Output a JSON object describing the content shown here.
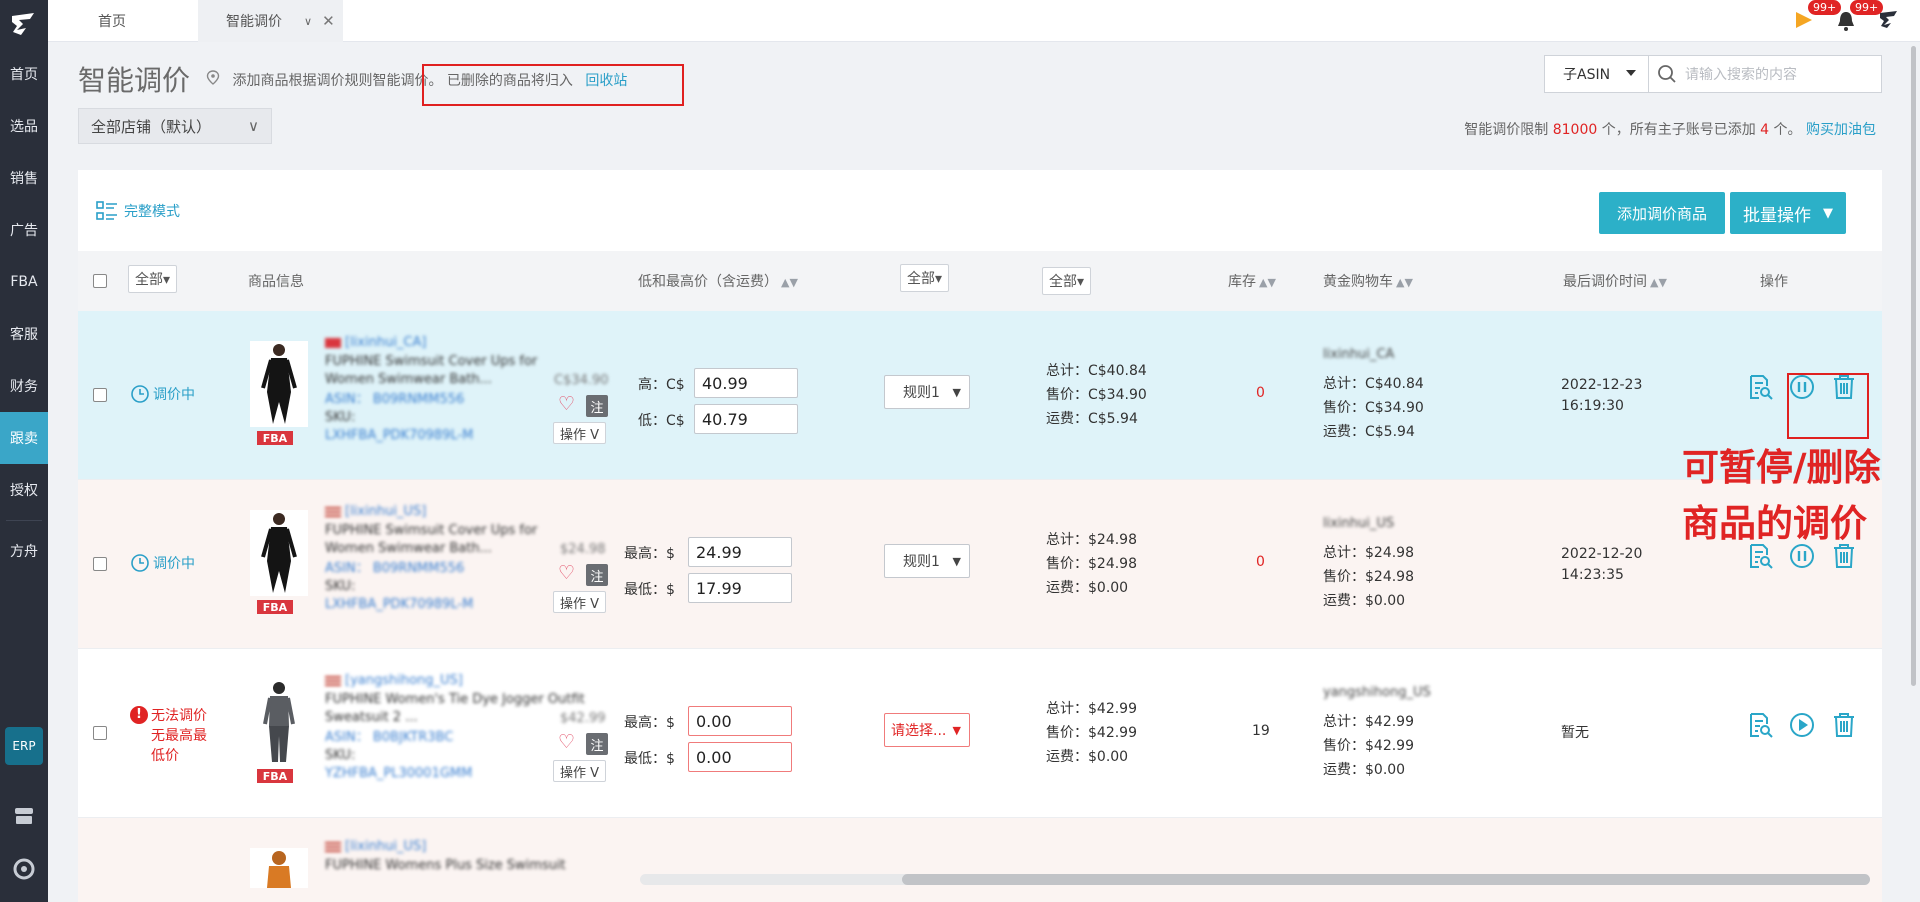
{
  "sidebar": {
    "items": [
      "首页",
      "选品",
      "销售",
      "广告",
      "FBA",
      "客服",
      "财务",
      "跟卖",
      "授权",
      "方舟"
    ],
    "active_index": 7,
    "erp": "ERP"
  },
  "tabs": {
    "home": "首页",
    "current": "智能调价"
  },
  "header": {
    "badge1": "99+",
    "badge2": "99+"
  },
  "page": {
    "title": "智能调价",
    "hint": "添加商品根据调价规则智能调价。 已删除的商品将归入",
    "recycle_link": "回收站",
    "store_select": "全部店铺（默认）"
  },
  "search": {
    "type": "子ASIN",
    "placeholder": "请输入搜索的内容"
  },
  "limit": {
    "prefix": "智能调价限制",
    "total": "81000",
    "mid": "个，所有主子账号已添加",
    "added": "4",
    "suffix": "个。",
    "link": "购买加油包"
  },
  "toolbar": {
    "mode": "完整模式",
    "add_button": "添加调价商品",
    "batch_button": "批量操作"
  },
  "table_header": {
    "all_status": "全部▾",
    "product_info": "商品信息",
    "price_range": "低和最高价（含运费）",
    "rule_all": "全部▾",
    "fee_all": "全部▾",
    "stock": "库存",
    "buybox": "黄金购物车",
    "last_time": "最后调价时间",
    "ops": "操作"
  },
  "rows": [
    {
      "status": "调价中",
      "status_type": "ok",
      "shop": "[lixinhui_CA]",
      "title1": "FUPHINE Swimsuit Cover Ups for",
      "title2": "Women Swimwear Bath...",
      "old_price": "C$34.90",
      "asin": "ASIN： B09RNMM556",
      "sku_label": "SKU:",
      "sku": "LXHFBA_PDK70989L-M",
      "op_label": "操作 V",
      "high_label": "高：",
      "low_label": "低：",
      "currency": "C$",
      "max_price": "40.99",
      "min_price": "40.79",
      "rule": "规则1",
      "total": "总计：C$40.84",
      "sell": "售价：C$34.90",
      "ship": "运费：C$5.94",
      "stock": "0",
      "buybox_seller": "lixinhui_CA",
      "bb_total": "总计：C$40.84",
      "bb_sell": "售价：C$34.90",
      "bb_ship": "运费：C$5.94",
      "time1": "2022-12-23",
      "time2": "16:19:30"
    },
    {
      "status": "调价中",
      "status_type": "ok",
      "shop": "[lixinhui_US]",
      "title1": "FUPHINE Swimsuit Cover Ups for",
      "title2": "Women Swimwear Bath...",
      "old_price": "$24.98",
      "asin": "ASIN： B09RNMM556",
      "sku_label": "SKU:",
      "sku": "LXHFBA_PDK70989L-M",
      "op_label": "操作 V",
      "high_label": "最高：",
      "low_label": "最低：",
      "currency": "$",
      "max_price": "24.99",
      "min_price": "17.99",
      "rule": "规则1",
      "total": "总计：$24.98",
      "sell": "售价：$24.98",
      "ship": "运费：$0.00",
      "stock": "0",
      "buybox_seller": "lixinhui_US",
      "bb_total": "总计：$24.98",
      "bb_sell": "售价：$24.98",
      "bb_ship": "运费：$0.00",
      "time1": "2022-12-20",
      "time2": "14:23:35"
    },
    {
      "status": "无法调价 无最高最低价",
      "status_type": "err",
      "shop": "[yangshihong_US]",
      "title1": "FUPHINE Women's Tie Dye Jogger Outfit",
      "title2": "Sweatsuit 2 ...",
      "old_price": "$42.99",
      "asin": "ASIN： B0BJKTR3BC",
      "sku_label": "SKU:",
      "sku": "YZHFBA_PL30001GMM",
      "op_label": "操作 V",
      "high_label": "最高：",
      "low_label": "最低：",
      "currency": "$",
      "max_price": "0.00",
      "min_price": "0.00",
      "rule": "请选择...",
      "total": "总计：$42.99",
      "sell": "售价：$42.99",
      "ship": "运费：$0.00",
      "stock": "19",
      "buybox_seller": "yangshihong_US",
      "bb_total": "总计：$42.99",
      "bb_sell": "售价：$42.99",
      "bb_ship": "运费：$0.00",
      "time1": "暂无",
      "time2": ""
    }
  ],
  "partial_row": {
    "shop": "[lixinhui_US]",
    "title1": "FUPHINE Womens Plus Size Swimsuit"
  },
  "annotation": {
    "line1": "可暂停/删除",
    "line2": "商品的调价"
  },
  "colors": {
    "accent": "#2cb0c8",
    "link": "#2a9fc8",
    "red": "#e02424",
    "row1_bg": "#dff3f9",
    "row2_bg": "#fbf4f2",
    "sidebar": "#2a2f3a"
  },
  "icons": [
    "logo-icon",
    "flag-icon",
    "bell-icon",
    "user-icon",
    "search-icon",
    "clock-icon",
    "error-icon",
    "heart-icon",
    "log-icon",
    "pause-icon",
    "play-icon",
    "trash-icon",
    "store-icon",
    "help-icon"
  ]
}
